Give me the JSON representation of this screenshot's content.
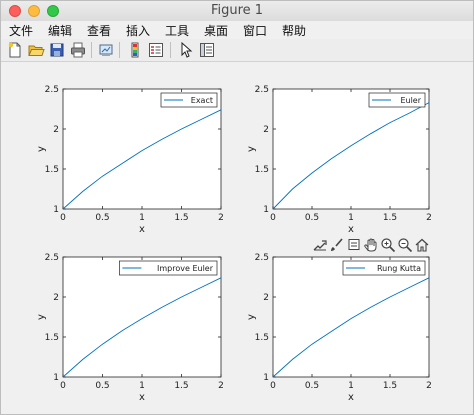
{
  "window": {
    "title": "Figure 1"
  },
  "menu": [
    "文件",
    "编辑",
    "查看",
    "插入",
    "工具",
    "桌面",
    "窗口",
    "帮助"
  ],
  "toolbar": {
    "icons": [
      "new-figure-icon",
      "open-file-icon",
      "save-icon",
      "print-icon",
      "link-plot-icon",
      "colorbar-icon",
      "legend-icon",
      "pointer-icon",
      "property-inspector-icon"
    ]
  },
  "axes_toolbar": {
    "icons": [
      "export-icon",
      "brush-icon",
      "data-tip-icon",
      "pan-icon",
      "zoom-in-icon",
      "zoom-out-icon",
      "home-icon"
    ]
  },
  "colors": {
    "line": "#0072bd",
    "axes_bg": "#ffffff",
    "figure_bg": "#f0f0f0"
  },
  "chart_data": [
    {
      "type": "line",
      "legend": [
        "Exact"
      ],
      "legend_position": "top-right",
      "xlabel": "x",
      "ylabel": "y",
      "xlim": [
        0,
        2
      ],
      "ylim": [
        1,
        2.5
      ],
      "xticks": [
        "0",
        "0.5",
        "1",
        "1.5",
        "2"
      ],
      "yticks": [
        "1",
        "1.5",
        "2",
        "2.5"
      ],
      "series": [
        {
          "name": "Exact",
          "x": [
            0,
            0.25,
            0.5,
            0.75,
            1.0,
            1.25,
            1.5,
            1.75,
            2.0
          ],
          "y": [
            1.0,
            1.22,
            1.41,
            1.57,
            1.73,
            1.87,
            2.0,
            2.12,
            2.24
          ]
        }
      ]
    },
    {
      "type": "line",
      "legend": [
        "Euler"
      ],
      "legend_position": "top-right",
      "xlabel": "x",
      "ylabel": "y",
      "xlim": [
        0,
        2
      ],
      "ylim": [
        1,
        2.5
      ],
      "xticks": [
        "0",
        "0.5",
        "1",
        "1.5",
        "2"
      ],
      "yticks": [
        "1",
        "1.5",
        "2",
        "2.5"
      ],
      "series": [
        {
          "name": "Euler",
          "x": [
            0,
            0.25,
            0.5,
            0.75,
            1.0,
            1.25,
            1.5,
            1.75,
            2.0
          ],
          "y": [
            1.0,
            1.25,
            1.45,
            1.63,
            1.79,
            1.94,
            2.08,
            2.2,
            2.33
          ]
        }
      ]
    },
    {
      "type": "line",
      "legend": [
        "Improve Euler"
      ],
      "legend_position": "top-right",
      "xlabel": "x",
      "ylabel": "y",
      "xlim": [
        0,
        2
      ],
      "ylim": [
        1,
        2.5
      ],
      "xticks": [
        "0",
        "0.5",
        "1",
        "1.5",
        "2"
      ],
      "yticks": [
        "1",
        "1.5",
        "2",
        "2.5"
      ],
      "series": [
        {
          "name": "Improve Euler",
          "x": [
            0,
            0.25,
            0.5,
            0.75,
            1.0,
            1.25,
            1.5,
            1.75,
            2.0
          ],
          "y": [
            1.0,
            1.22,
            1.41,
            1.58,
            1.73,
            1.87,
            2.0,
            2.12,
            2.24
          ]
        }
      ]
    },
    {
      "type": "line",
      "legend": [
        "Rung Kutta"
      ],
      "legend_position": "top-right",
      "xlabel": "x",
      "ylabel": "y",
      "xlim": [
        0,
        2
      ],
      "ylim": [
        1,
        2.5
      ],
      "xticks": [
        "0",
        "0.5",
        "1",
        "1.5",
        "2"
      ],
      "yticks": [
        "1",
        "1.5",
        "2",
        "2.5"
      ],
      "series": [
        {
          "name": "Rung Kutta",
          "x": [
            0,
            0.25,
            0.5,
            0.75,
            1.0,
            1.25,
            1.5,
            1.75,
            2.0
          ],
          "y": [
            1.0,
            1.22,
            1.41,
            1.57,
            1.73,
            1.87,
            2.0,
            2.12,
            2.24
          ]
        }
      ]
    }
  ]
}
